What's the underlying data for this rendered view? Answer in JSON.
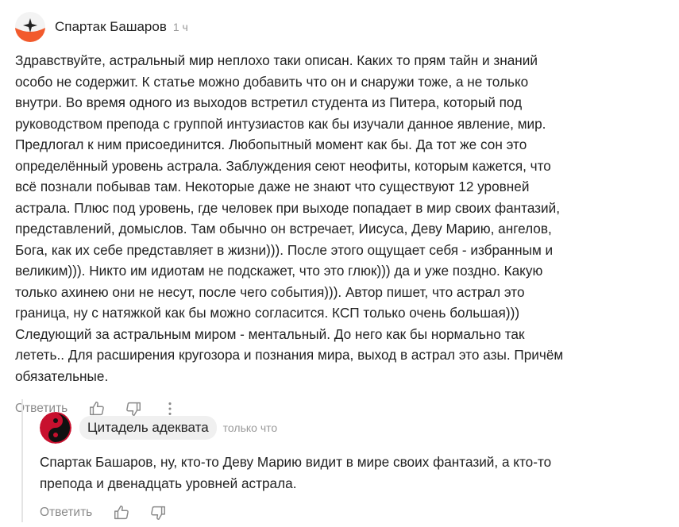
{
  "comment": {
    "author": "Спартак Башаров",
    "time": "1 ч",
    "text": "Здравствуйте, астральный мир неплохо таки описан. Каких то прям тайн и знаний\nособо не содержит. К статье можно добавить что он и снаружи тоже, а не только\nвнутри. Во время одного из выходов встретил студента из Питера, который под\nруководством препода с группой интузиастов как бы изучали данное явление, мир.\nПредлогал к ним присоединится. Любопытный момент как бы. Да тот же сон это\nопределённый уровень астрала. Заблуждения сеют неофиты, которым кажется, что\nвсё познали побывав там. Некоторые даже не знают что существуют 12 уровней\nастрала. Плюс под уровень, где человек при выходе попадает в мир своих фантазий,\nпредставлений, домыслов. Там обычно он встречает, Иисуса, Деву Марию, ангелов,\nБога, как их себе представляет в жизни))). После этого ощущает себя - избранным и\nвеликим))). Никто им идиотам не подскажет, что это глюк))) да и уже поздно. Какую\nтолько ахинею они не несут, после чего события))). Автор пишет, что астрал это\nграница, ну с натяжкой как бы можно согласится. КСП только очень большая)))\nСледующий за астральным миром - ментальный. До него как бы нормально так\nлететь.. Для расширения кругозора и познания мира, выход в астрал это азы. Причём\nобязательные.",
    "reply_label": "Ответить"
  },
  "reply": {
    "author": "Цитадель адеквата",
    "time": "только что",
    "text": "Спартак Башаров, ну, кто-то Деву Марию видит в мире своих фантазий, а кто-то\nпрепода и двенадцать уровней астрала.",
    "reply_label": "Ответить"
  },
  "colors": {
    "avatar_orange": "#f25a2c",
    "avatar_red": "#c8102e",
    "muted": "#8a8a8a"
  }
}
